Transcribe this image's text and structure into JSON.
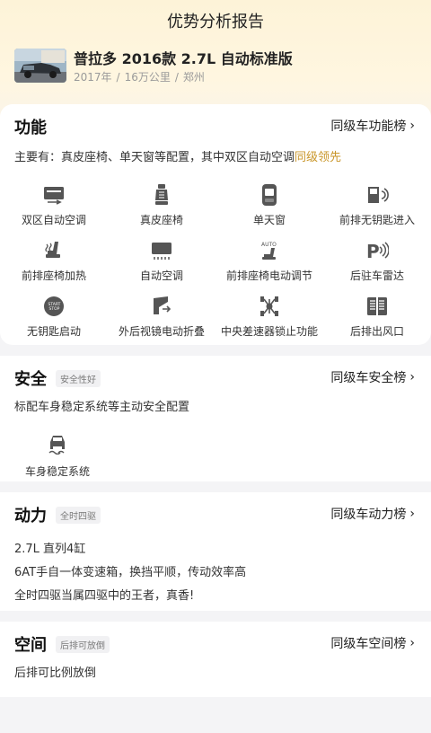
{
  "header": {
    "title": "优势分析报告",
    "car_name": "普拉多 2016款 2.7L 自动标准版",
    "meta": [
      "2017年",
      "16万公里",
      "郑州"
    ],
    "meta_sep": "/"
  },
  "feature": {
    "title": "功能",
    "rank_label": "同级车功能榜",
    "desc_prefix": "主要有：真皮座椅、单天窗等配置，其中双区自动空调",
    "desc_highlight": "同级领先",
    "highlight_color": "#c9962a",
    "items": [
      {
        "label": "双区自动空调",
        "icon": "dual-zone-ac-icon"
      },
      {
        "label": "真皮座椅",
        "icon": "leather-seat-icon"
      },
      {
        "label": "单天窗",
        "icon": "sunroof-icon"
      },
      {
        "label": "前排无钥匙进入",
        "icon": "keyless-entry-icon"
      },
      {
        "label": "前排座椅加热",
        "icon": "seat-heating-icon"
      },
      {
        "label": "自动空调",
        "icon": "auto-ac-icon"
      },
      {
        "label": "前排座椅电动调节",
        "icon": "power-seat-icon"
      },
      {
        "label": "后驻车雷达",
        "icon": "parking-radar-icon"
      },
      {
        "label": "无钥匙启动",
        "icon": "start-stop-icon"
      },
      {
        "label": "外后视镜电动折叠",
        "icon": "mirror-fold-icon"
      },
      {
        "label": "中央差速器锁止功能",
        "icon": "diff-lock-icon"
      },
      {
        "label": "后排出风口",
        "icon": "rear-vent-icon"
      }
    ]
  },
  "safety": {
    "title": "安全",
    "badge": "安全性好",
    "rank_label": "同级车安全榜",
    "desc": "标配车身稳定系统等主动安全配置",
    "item": {
      "label": "车身稳定系统",
      "icon": "stability-control-icon"
    }
  },
  "power": {
    "title": "动力",
    "badge": "全时四驱",
    "rank_label": "同级车动力榜",
    "lines": [
      "2.7L 直列4缸",
      "6AT手自一体变速箱，换挡平顺，传动效率高",
      "全时四驱当属四驱中的王者，真香!"
    ]
  },
  "space": {
    "title": "空间",
    "badge": "后排可放倒",
    "rank_label": "同级车空间榜",
    "desc": "后排可比例放倒"
  },
  "chevron": "›"
}
